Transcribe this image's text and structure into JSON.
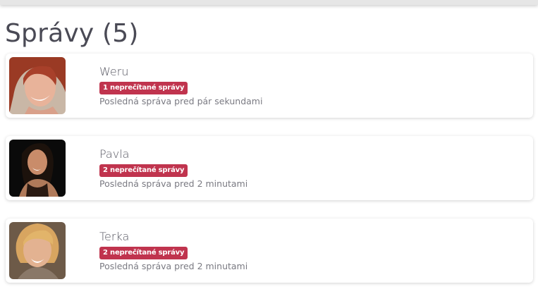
{
  "page": {
    "title": "Správy (5)"
  },
  "messages": [
    {
      "name": "Weru",
      "unread_label": "1 neprečítané správy",
      "last_message": "Posledná správa pred pár sekundami",
      "avatar": "woman-avatar-red-hair"
    },
    {
      "name": "Pavla",
      "unread_label": "2 neprečítané správy",
      "last_message": "Posledná správa pred 2 minutami",
      "avatar": "woman-avatar-dark-hair"
    },
    {
      "name": "Terka",
      "unread_label": "2 neprečítané správy",
      "last_message": "Posledná správa pred 2 minutami",
      "avatar": "woman-avatar-blonde-hair"
    }
  ],
  "colors": {
    "badge": "#c0344e",
    "title": "#4a4a55",
    "text_muted": "#7a7a82"
  }
}
